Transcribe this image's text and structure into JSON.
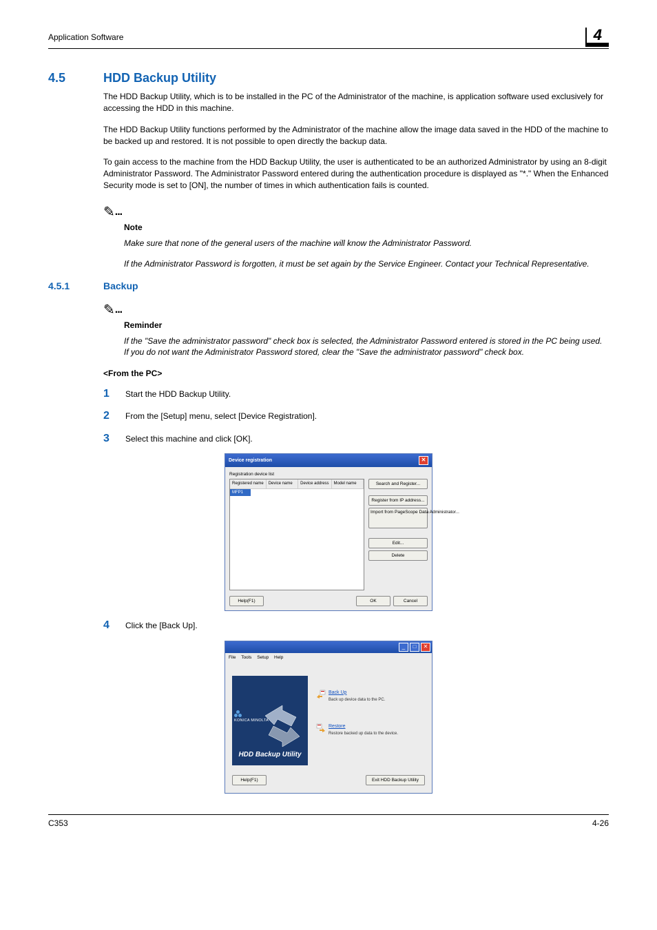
{
  "header": {
    "breadcrumb": "Application Software",
    "chapter": "4"
  },
  "sec45": {
    "num": "4.5",
    "title": "HDD Backup Utility",
    "p1": "The HDD Backup Utility, which is to be installed in the PC of the Administrator of the machine, is application software used exclusively for accessing the HDD in this machine.",
    "p2": "The HDD Backup Utility functions performed by the Administrator of the machine allow the image data saved in the HDD of the machine to be backed up and restored. It is not possible to open directly the backup data.",
    "p3": "To gain access to the machine from the HDD Backup Utility, the user is authenticated to be an authorized Administrator by using an 8-digit Administrator Password. The Administrator Password entered during the authentication procedure is displayed as \"*.\" When the Enhanced Security mode is set to [ON], the number of times in which authentication fails is counted."
  },
  "note1": {
    "label": "Note",
    "t1": "Make sure that none of the general users of the machine will know the Administrator Password.",
    "t2": "If the Administrator Password is forgotten, it must be set again by the Service Engineer. Contact your Technical Representative."
  },
  "sec451": {
    "num": "4.5.1",
    "title": "Backup"
  },
  "reminder": {
    "label": "Reminder",
    "t1": "If the \"Save the administrator password\" check box is selected, the Administrator Password entered is stored in the PC being used. If you do not want the Administrator Password stored, clear the \"Save the administrator password\" check box."
  },
  "fromPC": "<From the PC>",
  "steps": {
    "s1": "Start the HDD Backup Utility.",
    "s2": "From the [Setup] menu, select [Device Registration].",
    "s3": "Select this machine and click [OK].",
    "s4": "Click the [Back Up]."
  },
  "dlg1": {
    "title": "Device registration",
    "sub": "Registration device list",
    "cols": [
      "Registered name",
      "Device name",
      "Device address",
      "Model name"
    ],
    "row": "MFP1",
    "btns": {
      "search": "Search and Register...",
      "ip": "Register from IP address...",
      "import": "Import from PageScope Data Administrator...",
      "edit": "Edit...",
      "del": "Delete"
    },
    "help": "Help(F1)",
    "ok": "OK",
    "cancel": "Cancel"
  },
  "dlg2": {
    "menu": [
      "File",
      "Tools",
      "Setup",
      "Help"
    ],
    "brand": "KONICA MINOLTA",
    "util": "HDD Backup Utility",
    "backup_link": "Back Up",
    "backup_desc": "Back up device data to the PC.",
    "restore_link": "Restore",
    "restore_desc": "Restore backed up data to the device.",
    "help": "Help(F1)",
    "exit": "Exit HDD Backup Utility"
  },
  "footer": {
    "left": "C353",
    "right": "4-26"
  }
}
